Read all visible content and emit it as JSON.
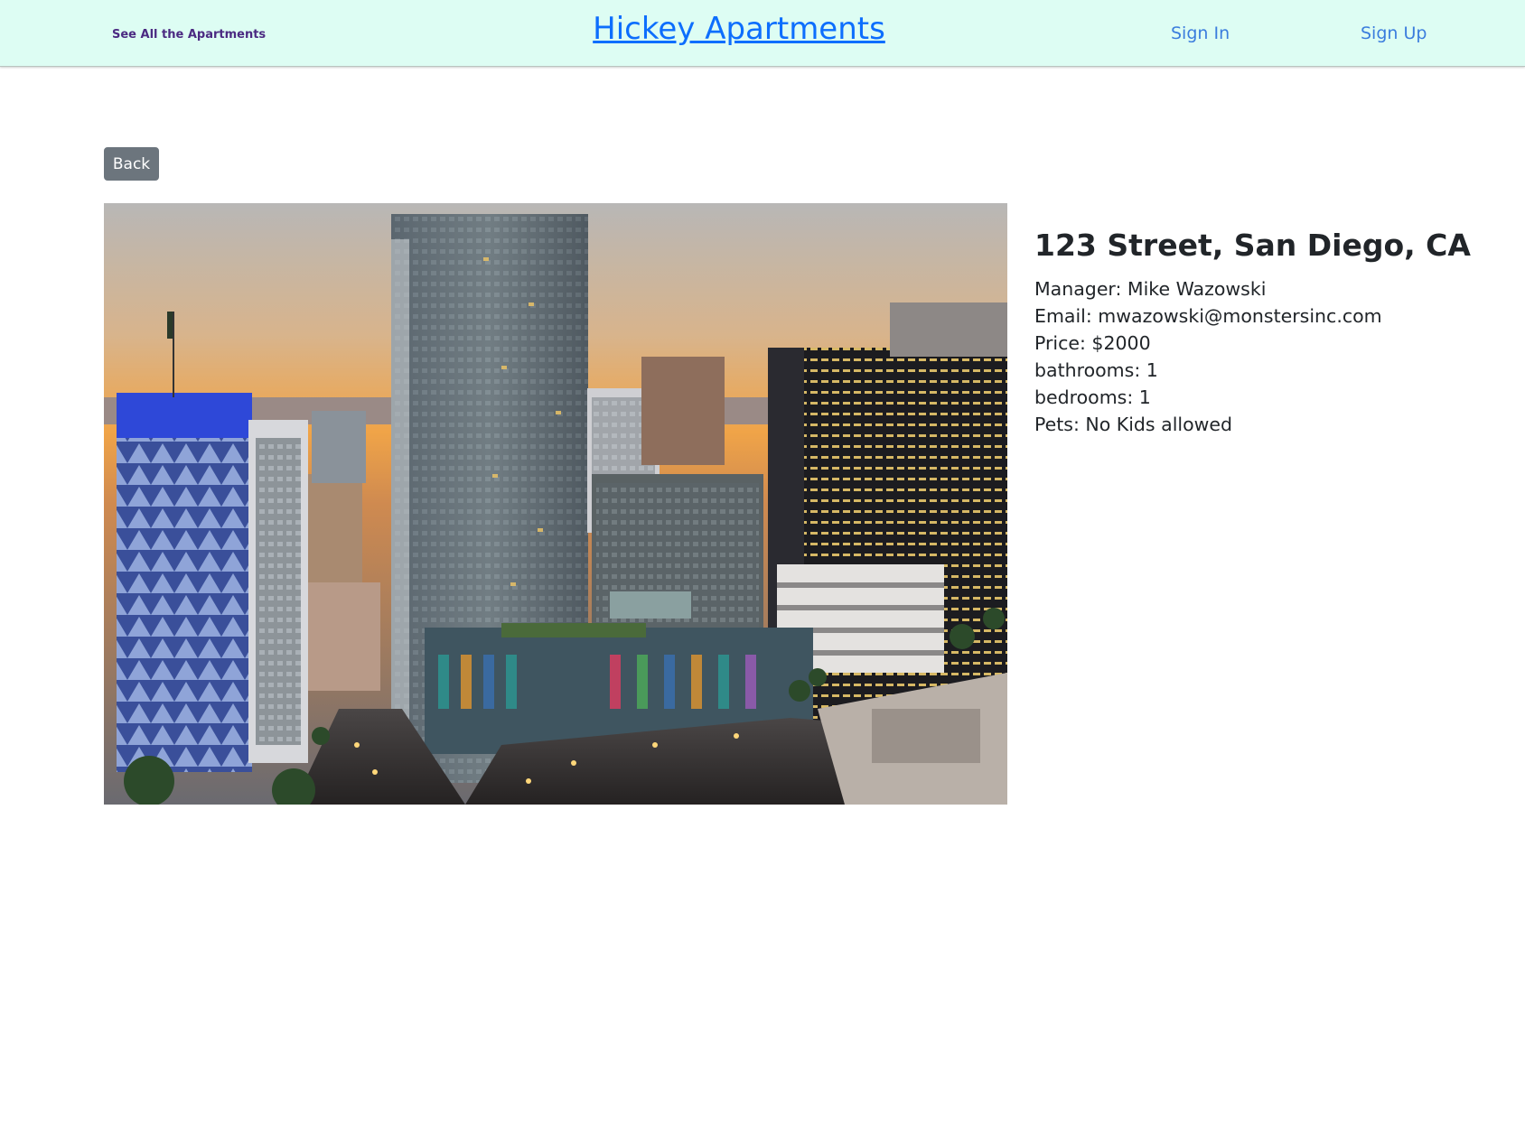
{
  "navbar": {
    "all_apartments_link": "See All the Apartments",
    "brand": "Hickey Apartments",
    "sign_in": "Sign In",
    "sign_up": "Sign Up"
  },
  "back_button": "Back",
  "listing": {
    "address": "123 Street, San Diego, CA",
    "manager": "Manager: Mike Wazowski",
    "email": "Email: mwazowski@monstersinc.com",
    "price": "Price: $2000",
    "bathrooms": "bathrooms: 1",
    "bedrooms": "bedrooms: 1",
    "pets": "Pets: No Kids allowed"
  },
  "colors": {
    "navbar_bg": "#ddfdf3",
    "brand_link": "#0d6efd",
    "nav_link": "#3b7ddd",
    "visited_link": "#4b2a82",
    "back_button_bg": "#6c757d"
  }
}
